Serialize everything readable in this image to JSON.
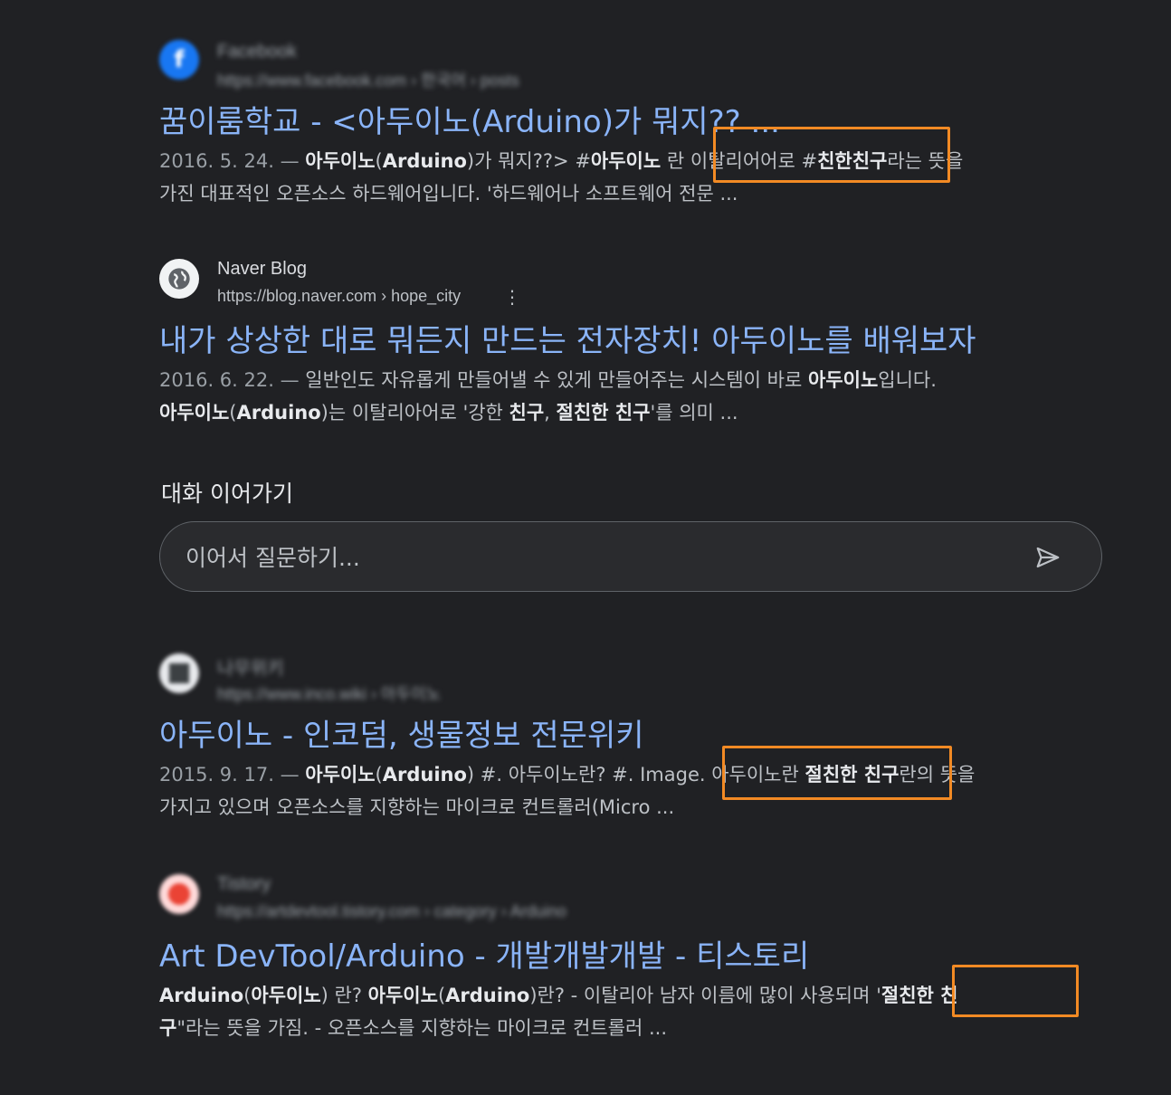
{
  "results": [
    {
      "source_name": "Facebook",
      "source_url": "https://www.facebook.com › 한국어 › posts",
      "title": "꿈이룸학교 - <아두이노(Arduino)가 뭐지?? ...",
      "snippet_line1": [
        {
          "t": "2016. 5. 24. — ",
          "s": "date"
        },
        {
          "t": "아두이노",
          "s": "b"
        },
        {
          "t": "(",
          "s": ""
        },
        {
          "t": "Arduino",
          "s": "b"
        },
        {
          "t": ")가 뭐지??> #",
          "s": ""
        },
        {
          "t": "아두이노",
          "s": "b"
        },
        {
          "t": " 란 이탈리어어로 #",
          "s": ""
        },
        {
          "t": "친한친구",
          "s": "b"
        },
        {
          "t": "라는 뜻을",
          "s": ""
        }
      ],
      "snippet_line2": "가진 대표적인 오픈소스 하드웨어입니다. '하드웨어나 소프트웨어 전문 ..."
    },
    {
      "source_name": "Naver Blog",
      "source_url": "https://blog.naver.com › hope_city",
      "title": "내가 상상한 대로 뭐든지 만드는 전자장치! 아두이노를 배워보자",
      "snippet_line1": [
        {
          "t": "2016. 6. 22. — ",
          "s": "date"
        },
        {
          "t": "일반인도 자유롭게 만들어낼 수 있게 만들어주는 시스템이 바로 ",
          "s": ""
        },
        {
          "t": "아두이노",
          "s": "b"
        },
        {
          "t": "입니다.",
          "s": ""
        }
      ],
      "snippet_line2_parts": [
        {
          "t": "아두이노",
          "s": "b"
        },
        {
          "t": "(",
          "s": ""
        },
        {
          "t": "Arduino",
          "s": "b"
        },
        {
          "t": ")는 이탈리아어로 '강한 ",
          "s": ""
        },
        {
          "t": "친구",
          "s": "b"
        },
        {
          "t": ", ",
          "s": ""
        },
        {
          "t": "절친한 친구",
          "s": "b"
        },
        {
          "t": "'를 의미 ...",
          "s": ""
        }
      ]
    },
    {
      "source_name": "나무위키",
      "source_url": "https://www.inco.wiki › 아두이노",
      "title": "아두이노 - 인코덤, 생물정보 전문위키",
      "snippet_line1": [
        {
          "t": "2015. 9. 17. — ",
          "s": "date"
        },
        {
          "t": "아두이노",
          "s": "b"
        },
        {
          "t": "(",
          "s": ""
        },
        {
          "t": "Arduino",
          "s": "b"
        },
        {
          "t": ") #. 아두이노란? #. Image. 아두이노란 ",
          "s": ""
        },
        {
          "t": "절친한 친구",
          "s": "b"
        },
        {
          "t": "란의 뜻을",
          "s": ""
        }
      ],
      "snippet_line2": "가지고 있으며 오픈소스를 지향하는 마이크로 컨트롤러(Micro ..."
    },
    {
      "source_name": "Tistory",
      "source_url": "https://artdevtool.tistory.com › category › Arduino",
      "title": "Art DevTool/Arduino - 개발개발개발 - 티스토리",
      "snippet_line1": [
        {
          "t": "Arduino",
          "s": "b"
        },
        {
          "t": "(",
          "s": ""
        },
        {
          "t": "아두이노",
          "s": "b"
        },
        {
          "t": ") 란? ",
          "s": ""
        },
        {
          "t": "아두이노",
          "s": "b"
        },
        {
          "t": "(",
          "s": ""
        },
        {
          "t": "Arduino",
          "s": "b"
        },
        {
          "t": ")란? - 이탈리아 남자 이름에 많이 사용되며 '",
          "s": ""
        },
        {
          "t": "절친한 친",
          "s": "b"
        }
      ],
      "snippet_line2_parts": [
        {
          "t": "구",
          "s": "b"
        },
        {
          "t": "\"라는 뜻을 가짐. - 오픈소스를 지향하는 마이크로 컨트롤러 ...",
          "s": ""
        }
      ]
    }
  ],
  "conversation": {
    "label": "대화 이어가기",
    "placeholder": "이어서 질문하기..."
  },
  "colors": {
    "background": "#202124",
    "link": "#8ab4f8",
    "highlight": "#f28a24"
  }
}
